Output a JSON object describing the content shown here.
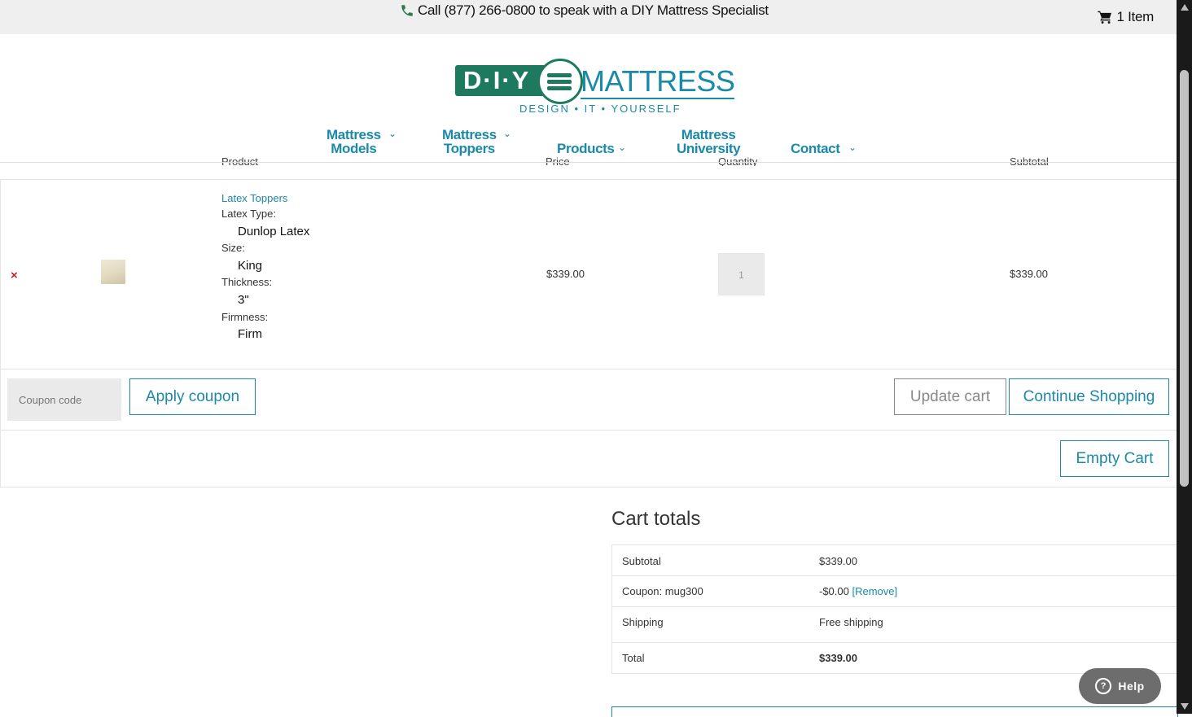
{
  "topbar": {
    "call_text": "Call (877) 266-0800 to speak with a DIY Mattress Specialist",
    "cart_text": "1 Item"
  },
  "logo": {
    "dtext": "D·I·Y",
    "brand": "MATTRESS",
    "tagline": "DESIGN • IT • YOURSELF"
  },
  "nav": {
    "models": [
      "Mattress",
      "Models"
    ],
    "toppers": [
      "Mattress",
      "Toppers"
    ],
    "products": "Products",
    "university": [
      "Mattress",
      "University"
    ],
    "contact": "Contact"
  },
  "table": {
    "headers": [
      "Product",
      "Price",
      "Quantity",
      "Subtotal"
    ],
    "item": {
      "remove_glyph": "×",
      "name": "Latex Toppers",
      "attributes": [
        {
          "label": "Latex Type:",
          "value": "Dunlop Latex"
        },
        {
          "label": "Size:",
          "value": "King"
        },
        {
          "label": "Thickness:",
          "value": "3\""
        },
        {
          "label": "Firmness:",
          "value": "Firm"
        }
      ],
      "price": "$339.00",
      "quantity": "1",
      "subtotal": "$339.00"
    },
    "coupon_placeholder": "Coupon code",
    "apply_coupon": "Apply coupon",
    "update_cart": "Update cart",
    "continue_shopping": "Continue Shopping",
    "empty_cart": "Empty Cart"
  },
  "totals": {
    "title": "Cart totals",
    "rows": [
      {
        "label": "Subtotal",
        "value": "$339.00"
      },
      {
        "label": "Coupon: mug300",
        "value": "-$0.00",
        "link": "[Remove]"
      },
      {
        "label": "Shipping",
        "value": "Free shipping"
      },
      {
        "label": "Total",
        "value": "$339.00"
      }
    ]
  },
  "help": {
    "label": "Help",
    "glyph": "?"
  },
  "colors": {
    "accent": "#1a8aa8",
    "brand_green": "#1e7a5e",
    "remove": "#bb2222"
  }
}
